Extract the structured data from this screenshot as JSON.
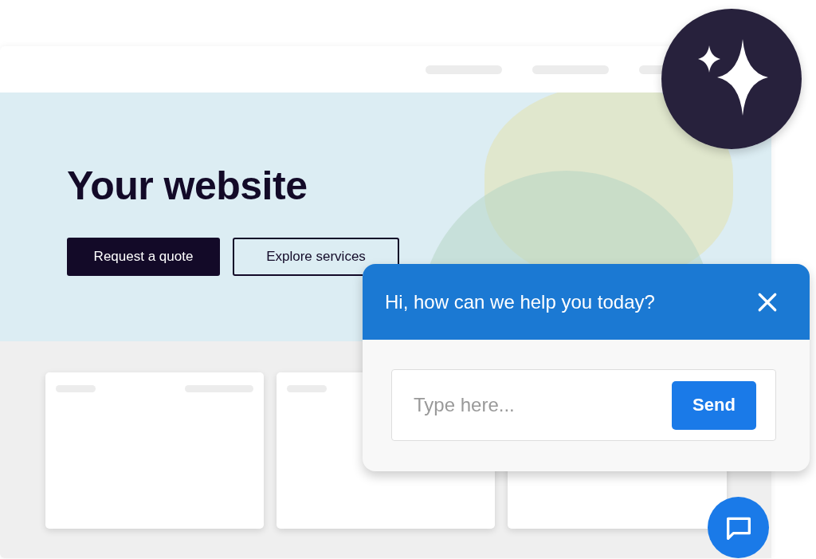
{
  "hero": {
    "title": "Your website",
    "buttons": [
      {
        "label": "Request a quote",
        "kind": "primary"
      },
      {
        "label": "Explore services",
        "kind": "outline"
      }
    ]
  },
  "chat": {
    "title": "Hi, how can we help you today?",
    "input": {
      "placeholder": "Type here..."
    },
    "send_button": "Send"
  }
}
